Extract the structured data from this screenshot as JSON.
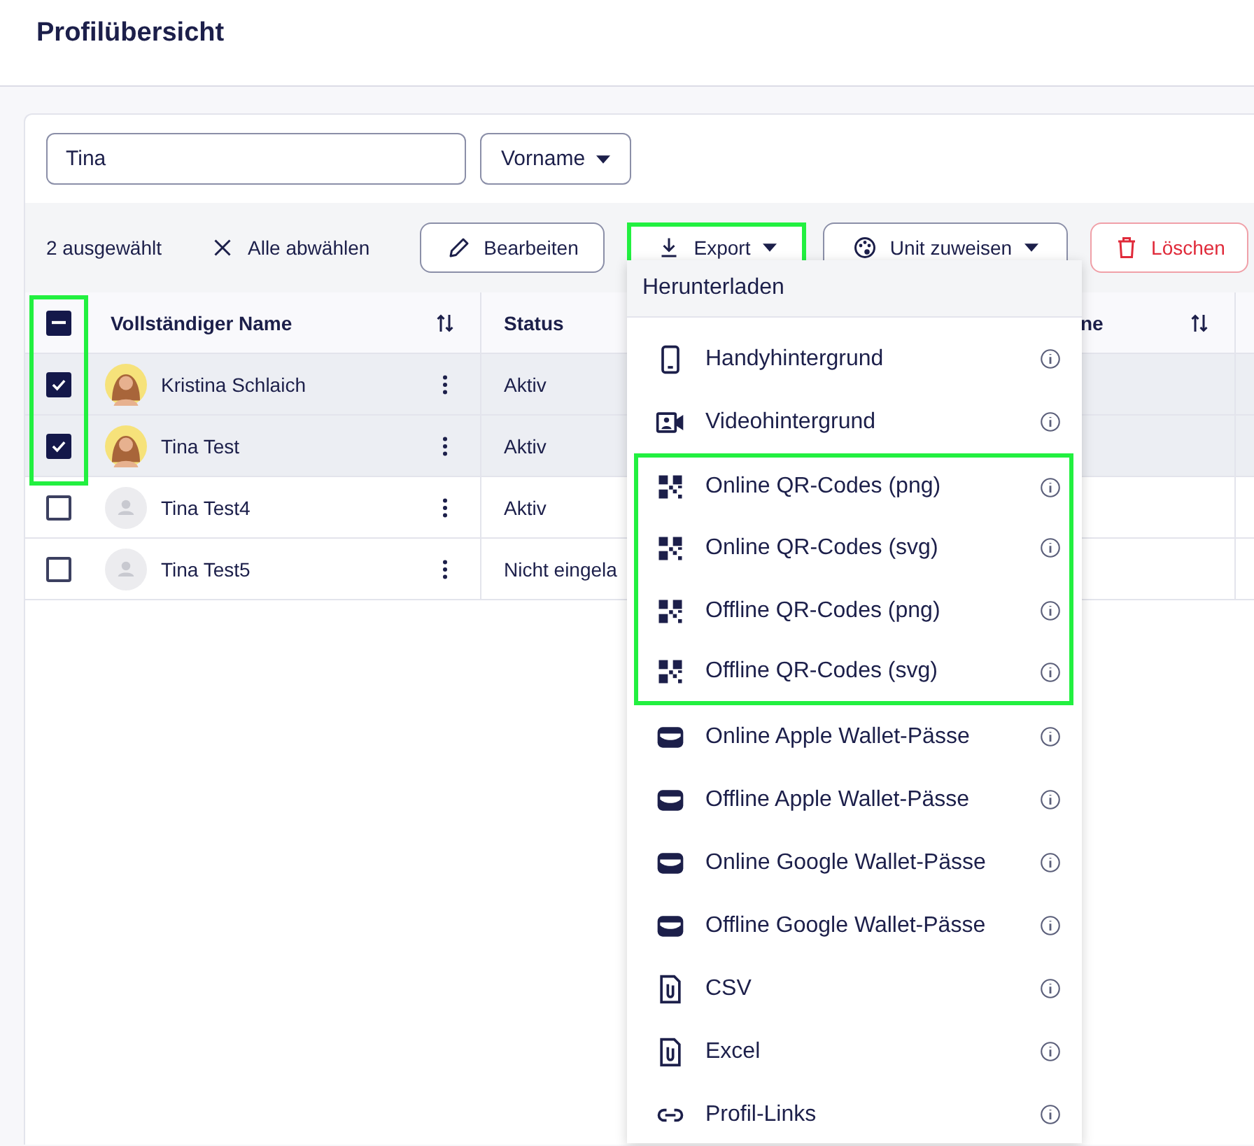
{
  "page": {
    "title": "Profilübersicht"
  },
  "filters": {
    "search": {
      "value": "Tina"
    },
    "field_select": {
      "label": "Vorname"
    }
  },
  "selection_bar": {
    "count": "2 ausgewählt",
    "deselect": "Alle abwählen",
    "buttons": [
      {
        "kind": "edit",
        "label": "Bearbeiten",
        "highlighted": false
      },
      {
        "kind": "export",
        "label": "Export",
        "highlighted": true,
        "expanded": true
      },
      {
        "kind": "assign",
        "label": "Unit zuweisen",
        "highlighted": false
      },
      {
        "kind": "delete",
        "label": "Löschen",
        "highlighted": false
      }
    ]
  },
  "table": {
    "select_all_checked": true,
    "select_all_partial": true,
    "checkbox_column_highlighted": true,
    "columns": [
      {
        "label": "Vollständiger Name",
        "kind": "sortable"
      },
      {
        "label": "Status",
        "kind": "plain"
      },
      {
        "label": "ne",
        "kind": "sortable"
      }
    ],
    "rows": [
      {
        "name": "Kristina Schlaich",
        "status": "Aktiv",
        "kind": "photo",
        "checked": true
      },
      {
        "name": "Tina Test",
        "status": "Aktiv",
        "kind": "photo",
        "checked": true
      },
      {
        "name": "Tina Test4",
        "status": "Aktiv",
        "kind": "placeholder",
        "checked": false
      },
      {
        "name": "Tina Test5",
        "status": "Nicht eingela",
        "kind": "placeholder",
        "checked": false
      }
    ]
  },
  "export_menu": {
    "header": "Herunterladen",
    "items": [
      {
        "kind": "phone",
        "label": "Handyhintergrund",
        "highlighted": false
      },
      {
        "kind": "video",
        "label": "Videohintergrund",
        "highlighted": false
      },
      {
        "kind": "qr",
        "label": "Online QR-Codes (png)",
        "highlighted": true
      },
      {
        "kind": "qr",
        "label": "Online QR-Codes (svg)",
        "highlighted": true
      },
      {
        "kind": "qr",
        "label": "Offline QR-Codes (png)",
        "highlighted": true
      },
      {
        "kind": "qr",
        "label": "Offline QR-Codes (svg)",
        "highlighted": true
      },
      {
        "kind": "wallet",
        "label": "Online Apple Wallet-Pässe",
        "highlighted": false
      },
      {
        "kind": "wallet",
        "label": "Offline Apple Wallet-Pässe",
        "highlighted": false
      },
      {
        "kind": "wallet",
        "label": "Online Google Wallet-Pässe",
        "highlighted": false
      },
      {
        "kind": "wallet",
        "label": "Offline Google Wallet-Pässe",
        "highlighted": false
      },
      {
        "kind": "file",
        "label": "CSV",
        "highlighted": false
      },
      {
        "kind": "file",
        "label": "Excel",
        "highlighted": false
      },
      {
        "kind": "link",
        "label": "Profil-Links",
        "highlighted": false
      }
    ]
  }
}
